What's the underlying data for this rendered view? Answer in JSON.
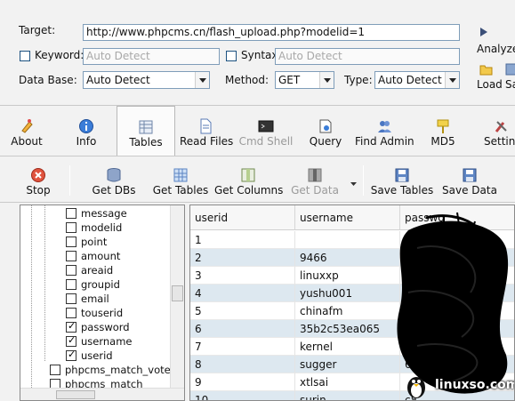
{
  "form": {
    "target_label": "Target:",
    "target_value": "http://www.phpcms.cn/flash_upload.php?modelid=1",
    "keyword_label": "Keyword:",
    "keyword_placeholder": "Auto Detect",
    "syntax_label": "Syntax:",
    "syntax_placeholder": "Auto Detect",
    "database_label": "Data Base:",
    "database_value": "Auto Detect",
    "method_label": "Method:",
    "method_value": "GET",
    "type_label": "Type:",
    "type_value": "Auto Detect"
  },
  "side_actions": {
    "analyze_label": "Analyze",
    "load_label": "Load",
    "save_label_partial": "Sa"
  },
  "toolbar1": {
    "items": [
      {
        "label": "About",
        "icon": "pencil-icon"
      },
      {
        "label": "Info",
        "icon": "info-icon"
      },
      {
        "label": "Tables",
        "icon": "table-icon"
      },
      {
        "label": "Read Files",
        "icon": "file-icon"
      },
      {
        "label": "Cmd Shell",
        "icon": "terminal-icon"
      },
      {
        "label": "Query",
        "icon": "query-icon"
      },
      {
        "label": "Find Admin",
        "icon": "users-icon"
      },
      {
        "label": "MD5",
        "icon": "key-icon"
      },
      {
        "label": "Settin",
        "icon": "settings-icon"
      }
    ],
    "active": "Tables"
  },
  "toolbar2": {
    "items": [
      {
        "label": "Stop",
        "icon": "stop-icon"
      },
      {
        "label": "Get DBs",
        "icon": "database-icon"
      },
      {
        "label": "Get Tables",
        "icon": "tables-icon"
      },
      {
        "label": "Get Columns",
        "icon": "columns-icon"
      },
      {
        "label": "Get Data",
        "icon": "data-icon"
      },
      {
        "label": "Save Tables",
        "icon": "floppy-icon"
      },
      {
        "label": "Save Data",
        "icon": "floppy-icon"
      }
    ]
  },
  "tree": {
    "items": [
      {
        "label": "message",
        "checked": false
      },
      {
        "label": "modelid",
        "checked": false
      },
      {
        "label": "point",
        "checked": false
      },
      {
        "label": "amount",
        "checked": false
      },
      {
        "label": "areaid",
        "checked": false
      },
      {
        "label": "groupid",
        "checked": false
      },
      {
        "label": "email",
        "checked": false
      },
      {
        "label": "touserid",
        "checked": false
      },
      {
        "label": "password",
        "checked": true
      },
      {
        "label": "username",
        "checked": true
      },
      {
        "label": "userid",
        "checked": true
      }
    ],
    "tables": [
      {
        "label": "phpcms_match_vote",
        "checked": false
      },
      {
        "label": "phpcms_match",
        "checked": false
      }
    ]
  },
  "grid": {
    "columns": [
      "userid",
      "username",
      "passwo"
    ],
    "rows": [
      [
        "1",
        "",
        ""
      ],
      [
        "2",
        "9466",
        ""
      ],
      [
        "3",
        "linuxxp",
        ""
      ],
      [
        "4",
        "yushu001",
        ""
      ],
      [
        "5",
        "chinafm",
        ""
      ],
      [
        "6",
        "35b2c53ea065",
        ""
      ],
      [
        "7",
        "kernel",
        "0"
      ],
      [
        "8",
        "sugger",
        "6"
      ],
      [
        "9",
        "xtlsai",
        ""
      ],
      [
        "10",
        "surin",
        "c8"
      ]
    ]
  },
  "watermark": {
    "text": "linuxso.com"
  },
  "colors": {
    "row_alt": "#dde8f0",
    "accent": "#7f9db9"
  }
}
